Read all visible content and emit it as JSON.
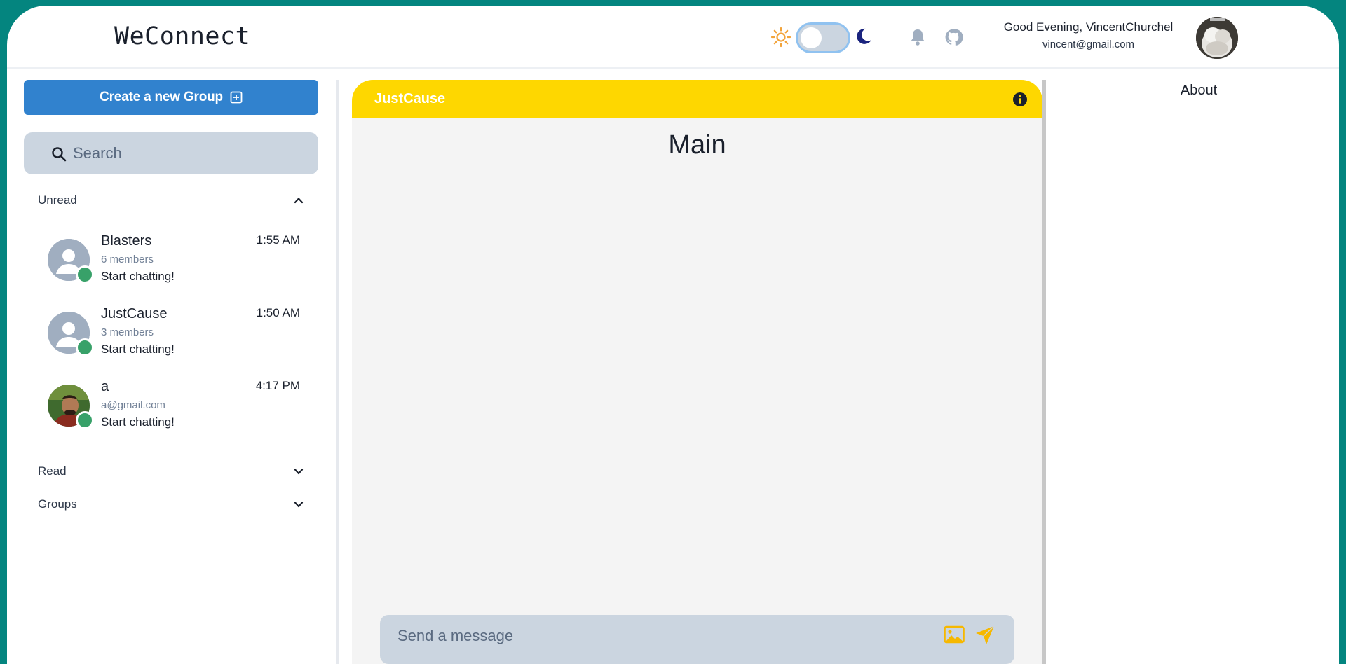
{
  "app": {
    "logo": "WeConnect"
  },
  "header": {
    "greeting": "Good Evening, VincentChurchel",
    "email": "vincent@gmail.com",
    "theme_toggle_state": "light",
    "icons": [
      "sun-icon",
      "moon-icon",
      "bell-icon",
      "github-icon"
    ]
  },
  "sidebar": {
    "create_group_label": "Create a new Group",
    "search_placeholder": "Search",
    "sections": {
      "unread": "Unread",
      "read": "Read",
      "groups": "Groups"
    },
    "chats": [
      {
        "name": "Blasters",
        "sub": "6 members",
        "message": "Start chatting!",
        "time": "1:55 AM",
        "online": true
      },
      {
        "name": "JustCause",
        "sub": "3 members",
        "message": "Start chatting!",
        "time": "1:50 AM",
        "online": true
      },
      {
        "name": "a",
        "sub": "a@gmail.com",
        "message": "Start chatting!",
        "time": "4:17 PM",
        "online": true
      }
    ]
  },
  "chat": {
    "title": "JustCause",
    "channel": "Main",
    "composer_placeholder": "Send a message"
  },
  "details": {
    "about_label": "About"
  },
  "colors": {
    "background": "#04857f",
    "primary": "#3182ce",
    "chat_header": "#fed700",
    "online": "#38a169",
    "send": "#f6b800"
  }
}
